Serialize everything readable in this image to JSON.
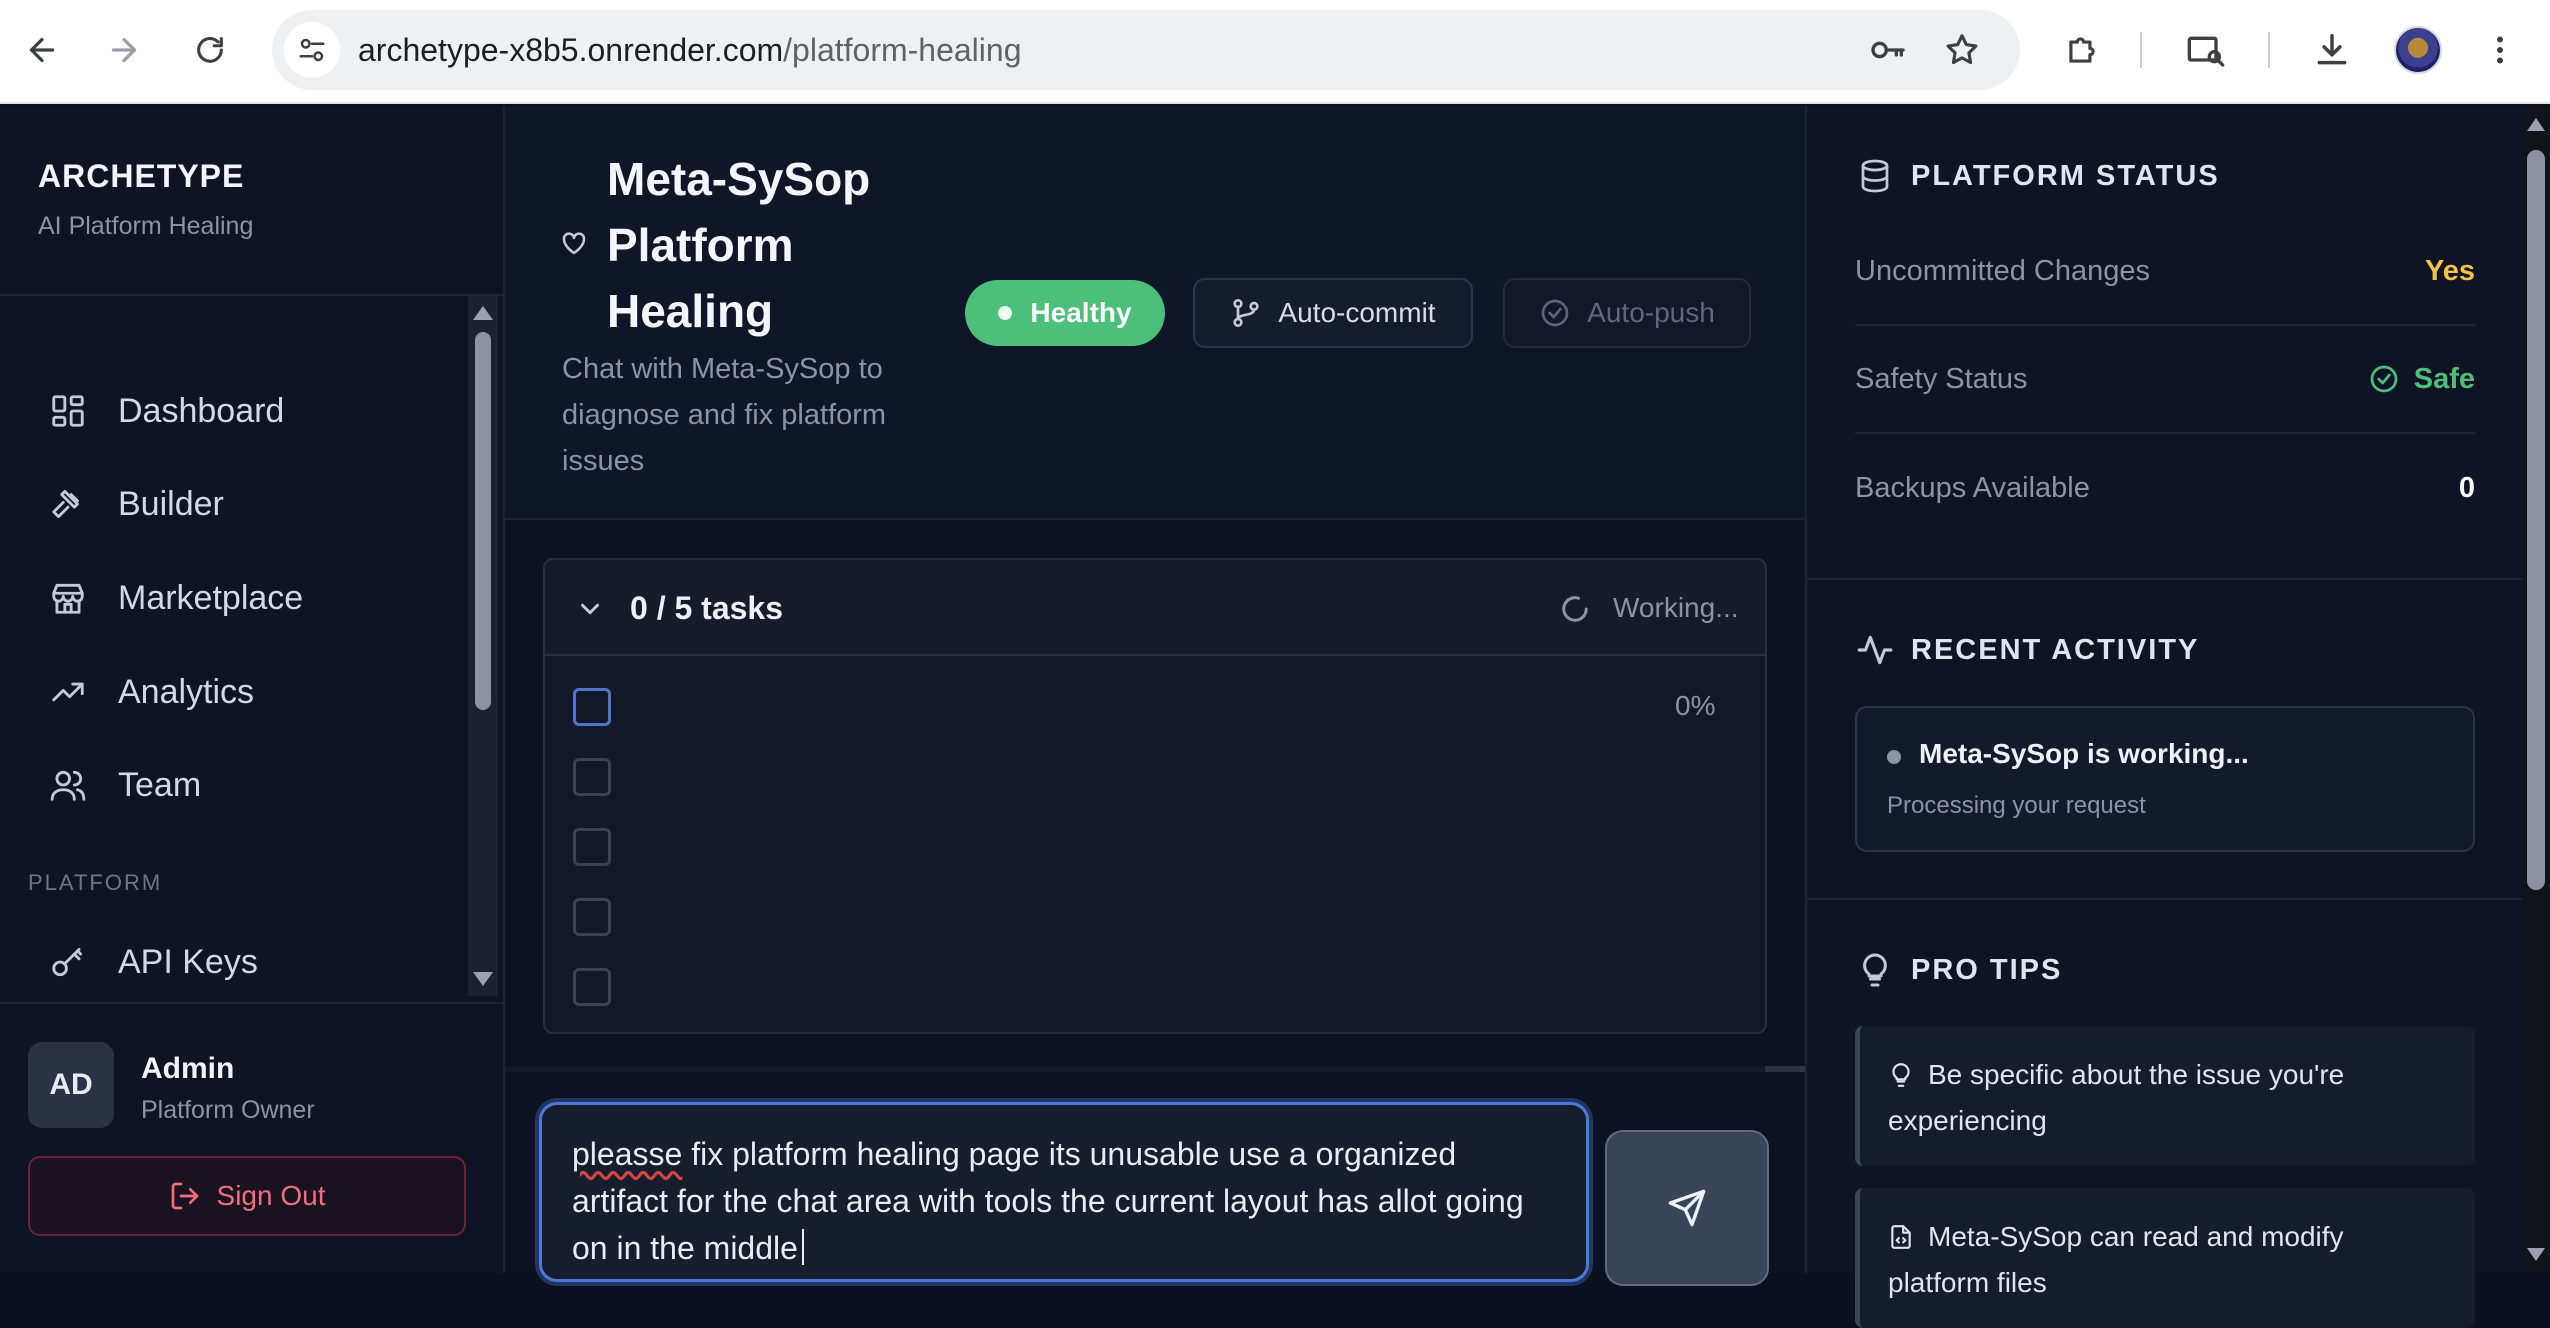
{
  "browser": {
    "url_domain": "archetype-x8b5.onrender.com",
    "url_path": "/platform-healing"
  },
  "sidebar": {
    "brand_title": "ARCHETYPE",
    "brand_subtitle": "AI Platform Healing",
    "items": [
      {
        "label": "Dashboard",
        "icon": "dashboard-grid-icon"
      },
      {
        "label": "Builder",
        "icon": "hammer-icon"
      },
      {
        "label": "Marketplace",
        "icon": "store-icon"
      },
      {
        "label": "Analytics",
        "icon": "trending-up-icon"
      },
      {
        "label": "Team",
        "icon": "users-icon"
      }
    ],
    "section_label": "PLATFORM",
    "platform_items": [
      {
        "label": "API Keys",
        "icon": "key-icon"
      }
    ],
    "user": {
      "initials": "AD",
      "name": "Admin",
      "role": "Platform Owner"
    },
    "sign_out_label": "Sign Out"
  },
  "main": {
    "title": "Meta-SySop Platform Healing",
    "title_lines": [
      "Meta-SySop",
      "Platform",
      "Healing"
    ],
    "subtitle": "Chat with Meta-SySop to diagnose and fix platform issues",
    "status_pill": "Healthy",
    "auto_commit_label": "Auto-commit",
    "auto_push_label": "Auto-push",
    "tasks": {
      "count_label": "0 / 5 tasks",
      "status_label": "Working...",
      "progress_label": "0%",
      "progress": 0,
      "items": [
        {
          "checked": false
        },
        {
          "checked": false
        },
        {
          "checked": false
        },
        {
          "checked": false
        },
        {
          "checked": false
        }
      ]
    },
    "composer": {
      "typo_word": "pleasse",
      "value_rest": " fix platform healing page its unusable use a organized artifact for the chat area with tools the current layout has allot going on in the middle"
    }
  },
  "right": {
    "status_title": "PLATFORM STATUS",
    "stats": [
      {
        "label": "Uncommitted Changes",
        "value": "Yes",
        "color": "#f5c244"
      },
      {
        "label": "Safety Status",
        "value": "Safe",
        "color": "#4cc07a"
      },
      {
        "label": "Backups Available",
        "value": "0",
        "color": "#ffffff"
      }
    ],
    "activity_title": "RECENT ACTIVITY",
    "activity": {
      "title": "Meta-SySop is working...",
      "subtitle": "Processing your request"
    },
    "tips_title": "PRO TIPS",
    "tips": [
      {
        "text": "Be specific about the issue you're experiencing",
        "icon": "lightbulb-icon"
      },
      {
        "text": "Meta-SySop can read and modify platform files",
        "icon": "file-code-icon"
      }
    ]
  },
  "colors": {
    "accent_blue": "#4f79d8",
    "healthy_green": "#4cc07a",
    "warning_yellow": "#f5c244",
    "danger_red": "#f26d7d"
  }
}
